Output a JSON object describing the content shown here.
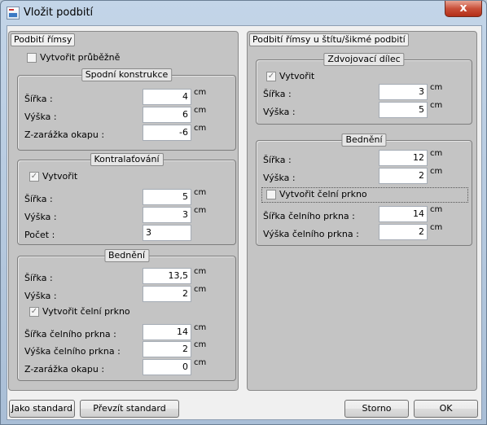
{
  "window": {
    "title": "Vložit podbití",
    "close_glyph": "x"
  },
  "left_panel": {
    "title": "Podbití římsy",
    "continuous": {
      "label": "Vytvořit průběžně",
      "checked": false
    },
    "substructure": {
      "title": "Spodní konstrukce",
      "width": {
        "label": "Šířka :",
        "value": "4",
        "unit": "cm"
      },
      "height": {
        "label": "Výška :",
        "value": "6",
        "unit": "cm"
      },
      "eaves_offset": {
        "label": "Z-zarážka okapu :",
        "value": "-6",
        "unit": "cm"
      }
    },
    "counter_battens": {
      "title": "Kontralaťování",
      "create": {
        "label": "Vytvořit",
        "checked": true
      },
      "width": {
        "label": "Šířka :",
        "value": "5",
        "unit": "cm"
      },
      "height": {
        "label": "Výška :",
        "value": "3",
        "unit": "cm"
      },
      "count": {
        "label": "Počet :",
        "value": "3"
      }
    },
    "boarding": {
      "title": "Bednění",
      "width": {
        "label": "Šířka :",
        "value": "13,5",
        "unit": "cm"
      },
      "height": {
        "label": "Výška :",
        "value": "2",
        "unit": "cm"
      },
      "fascia": {
        "label": "Vytvořit čelní prkno",
        "checked": true
      },
      "fascia_width": {
        "label": "Šířka čelního prkna :",
        "value": "14",
        "unit": "cm"
      },
      "fascia_height": {
        "label": "Výška čelního prkna :",
        "value": "2",
        "unit": "cm"
      },
      "eaves_offset": {
        "label": "Z-zarážka okapu :",
        "value": "0",
        "unit": "cm"
      }
    }
  },
  "right_panel": {
    "title": "Podbití římsy u štítu/šikmé podbití",
    "doubling": {
      "title": "Zdvojovací dílec",
      "create": {
        "label": "Vytvořit",
        "checked": true
      },
      "width": {
        "label": "Šířka :",
        "value": "3",
        "unit": "cm"
      },
      "height": {
        "label": "Výška :",
        "value": "5",
        "unit": "cm"
      }
    },
    "boarding": {
      "title": "Bednění",
      "width": {
        "label": "Šířka :",
        "value": "12",
        "unit": "cm"
      },
      "height": {
        "label": "Výška :",
        "value": "2",
        "unit": "cm"
      },
      "fascia": {
        "label": "Vytvořit čelní prkno",
        "checked": false
      },
      "fascia_width": {
        "label": "Šířka čelního prkna :",
        "value": "14",
        "unit": "cm"
      },
      "fascia_height": {
        "label": "Výška čelního prkna :",
        "value": "2",
        "unit": "cm"
      }
    }
  },
  "buttons": {
    "as_standard": "Jako standard",
    "take_standard": "Převzít standard",
    "cancel": "Storno",
    "ok": "OK"
  }
}
